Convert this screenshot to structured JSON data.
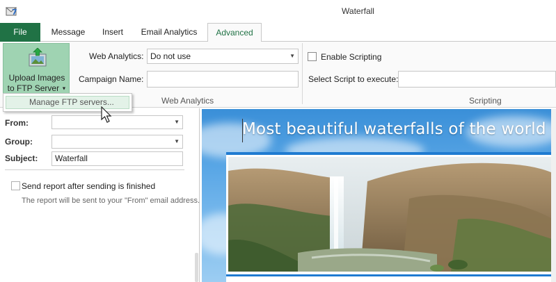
{
  "window": {
    "title": "Waterfall"
  },
  "tabs": [
    {
      "label": "File"
    },
    {
      "label": "Message"
    },
    {
      "label": "Insert"
    },
    {
      "label": "Email Analytics"
    },
    {
      "label": "Advanced"
    }
  ],
  "ribbon": {
    "upload": {
      "line1": "Upload Images",
      "line2": "to FTP Server"
    },
    "web_analytics": {
      "label": "Web Analytics:",
      "value": "Do not use",
      "campaign_label": "Campaign Name:",
      "campaign_value": "",
      "group_label": "Web Analytics"
    },
    "scripting": {
      "enable_label": "Enable Scripting",
      "select_label": "Select Script to execute:",
      "select_value": "",
      "group_label": "Scripting"
    }
  },
  "popup": {
    "item": "Manage FTP servers..."
  },
  "left": {
    "from_label": "From:",
    "from_value": "",
    "group_label": "Group:",
    "group_value": "",
    "subject_label": "Subject:",
    "subject_value": "Waterfall",
    "send_report_label": "Send report after sending is finished",
    "note": "The report will be sent to your \"From\" email address."
  },
  "preview": {
    "heading": "Most beautiful waterfalls of the world"
  },
  "colors": {
    "accent": "#207245",
    "brand_blue": "#1f7bd1"
  }
}
